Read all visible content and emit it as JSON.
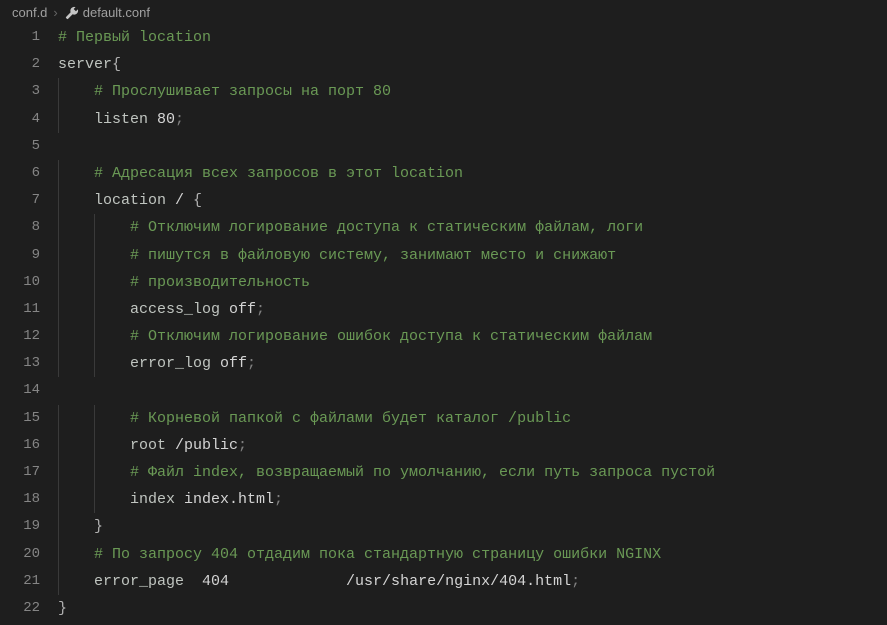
{
  "breadcrumb": {
    "folder": "conf.d",
    "file": "default.conf"
  },
  "code": {
    "lines": [
      {
        "n": 1,
        "indent": 0,
        "segs": [
          {
            "t": "# Первый location",
            "c": "tok-comment"
          }
        ]
      },
      {
        "n": 2,
        "indent": 0,
        "segs": [
          {
            "t": "server",
            "c": "tok-keyword"
          },
          {
            "t": "{",
            "c": "tok-punct"
          }
        ]
      },
      {
        "n": 3,
        "indent": 1,
        "segs": [
          {
            "t": "# Прослушивает запросы на порт 80",
            "c": "tok-comment"
          }
        ]
      },
      {
        "n": 4,
        "indent": 1,
        "segs": [
          {
            "t": "listen ",
            "c": "tok-keyword"
          },
          {
            "t": "80",
            "c": "tok-value"
          },
          {
            "t": ";",
            "c": "tok-semicolon"
          }
        ]
      },
      {
        "n": 5,
        "indent": 0,
        "segs": []
      },
      {
        "n": 6,
        "indent": 1,
        "segs": [
          {
            "t": "# Адресация всех запросов в этот location",
            "c": "tok-comment"
          }
        ]
      },
      {
        "n": 7,
        "indent": 1,
        "segs": [
          {
            "t": "location ",
            "c": "tok-keyword"
          },
          {
            "t": "/ ",
            "c": "tok-value"
          },
          {
            "t": "{",
            "c": "tok-punct"
          }
        ]
      },
      {
        "n": 8,
        "indent": 2,
        "segs": [
          {
            "t": "# Отключим логирование доступа к статическим файлам, логи",
            "c": "tok-comment"
          }
        ]
      },
      {
        "n": 9,
        "indent": 2,
        "segs": [
          {
            "t": "# пишутся в файловую систему, занимают место и снижают",
            "c": "tok-comment"
          }
        ]
      },
      {
        "n": 10,
        "indent": 2,
        "segs": [
          {
            "t": "# производительность",
            "c": "tok-comment"
          }
        ]
      },
      {
        "n": 11,
        "indent": 2,
        "segs": [
          {
            "t": "access_log ",
            "c": "tok-keyword"
          },
          {
            "t": "off",
            "c": "tok-value"
          },
          {
            "t": ";",
            "c": "tok-semicolon"
          }
        ]
      },
      {
        "n": 12,
        "indent": 2,
        "segs": [
          {
            "t": "# Отключим логирование ошибок доступа к статическим файлам",
            "c": "tok-comment"
          }
        ]
      },
      {
        "n": 13,
        "indent": 2,
        "segs": [
          {
            "t": "error_log ",
            "c": "tok-keyword"
          },
          {
            "t": "off",
            "c": "tok-value"
          },
          {
            "t": ";",
            "c": "tok-semicolon"
          }
        ]
      },
      {
        "n": 14,
        "indent": 0,
        "segs": []
      },
      {
        "n": 15,
        "indent": 2,
        "segs": [
          {
            "t": "# Корневой папкой с файлами будет каталог /public",
            "c": "tok-comment"
          }
        ]
      },
      {
        "n": 16,
        "indent": 2,
        "segs": [
          {
            "t": "root ",
            "c": "tok-keyword"
          },
          {
            "t": "/public",
            "c": "tok-value"
          },
          {
            "t": ";",
            "c": "tok-semicolon"
          }
        ]
      },
      {
        "n": 17,
        "indent": 2,
        "segs": [
          {
            "t": "# Файл index, возвращаемый по умолчанию, если путь запроса пустой",
            "c": "tok-comment"
          }
        ]
      },
      {
        "n": 18,
        "indent": 2,
        "segs": [
          {
            "t": "index ",
            "c": "tok-keyword"
          },
          {
            "t": "index.html",
            "c": "tok-value"
          },
          {
            "t": ";",
            "c": "tok-semicolon"
          }
        ]
      },
      {
        "n": 19,
        "indent": 1,
        "segs": [
          {
            "t": "}",
            "c": "tok-punct"
          }
        ]
      },
      {
        "n": 20,
        "indent": 1,
        "segs": [
          {
            "t": "# По запросу 404 отдадим пока стандартную страницу ошибки NGINX",
            "c": "tok-comment"
          }
        ]
      },
      {
        "n": 21,
        "indent": 1,
        "segs": [
          {
            "t": "error_page  ",
            "c": "tok-keyword"
          },
          {
            "t": "404             /usr/share/nginx/404.html",
            "c": "tok-value"
          },
          {
            "t": ";",
            "c": "tok-semicolon"
          }
        ]
      },
      {
        "n": 22,
        "indent": 0,
        "segs": [
          {
            "t": "}",
            "c": "tok-punct"
          }
        ]
      }
    ]
  }
}
